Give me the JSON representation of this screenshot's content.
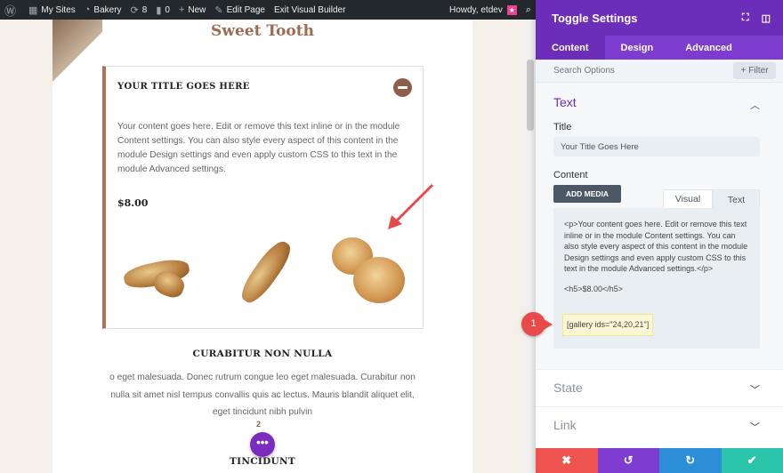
{
  "admin_bar": {
    "sites": "My Sites",
    "site_name": "Bakery",
    "updates": "8",
    "comments": "0",
    "new": "New",
    "edit_page": "Edit Page",
    "exit_builder": "Exit Visual Builder",
    "howdy": "Howdy, etdev"
  },
  "page": {
    "site_title": "Sweet Tooth",
    "toggle_title": "YOUR TITLE GOES HERE",
    "toggle_body": "Your content goes here. Edit or remove this text inline or in the module Content settings. You can also style every aspect of this content in the module Design settings and even apply custom CSS to this text in the module Advanced settings.",
    "price": "$8.00",
    "section_heading": "CURABITUR NON NULLA",
    "section_text": "o eget malesuada. Donec rutrum congue leo eget malesuada. Curabitur non nulla sit amet nisl tempus convallis quis ac lectus. Mauris blandit aliquet elit, eget tincidunt nibh pulvin",
    "badge_count": "2",
    "dots_label": "•••",
    "next_heading": "TINCIDUNT"
  },
  "panel": {
    "title": "Toggle Settings",
    "tabs": [
      "Content",
      "Design",
      "Advanced"
    ],
    "search_placeholder": "Search Options",
    "filter_label": "Filter",
    "section_text": "Text",
    "title_label": "Title",
    "title_value": "Your Title Goes Here",
    "content_label": "Content",
    "add_media": "ADD MEDIA",
    "editor_tabs": [
      "Visual",
      "Text"
    ],
    "editor_lines": [
      "<p>Your content goes here. Edit or remove this text inline or in the module Content settings. You can also style every aspect of this content in the module Design settings and even apply custom CSS to this text in the module Advanced settings.</p>",
      "<h5>$8.00</h5>"
    ],
    "shortcode": "[gallery ids=\"24,20,21\"]",
    "marker": "1",
    "sections": [
      "State",
      "Link"
    ]
  },
  "colors": {
    "accent_purple": "#6c2eb9",
    "cancel_red": "#ef5350",
    "undo_purple": "#7e3bd0",
    "redo_blue": "#2b8ed6",
    "save_green": "#29c4a9"
  }
}
